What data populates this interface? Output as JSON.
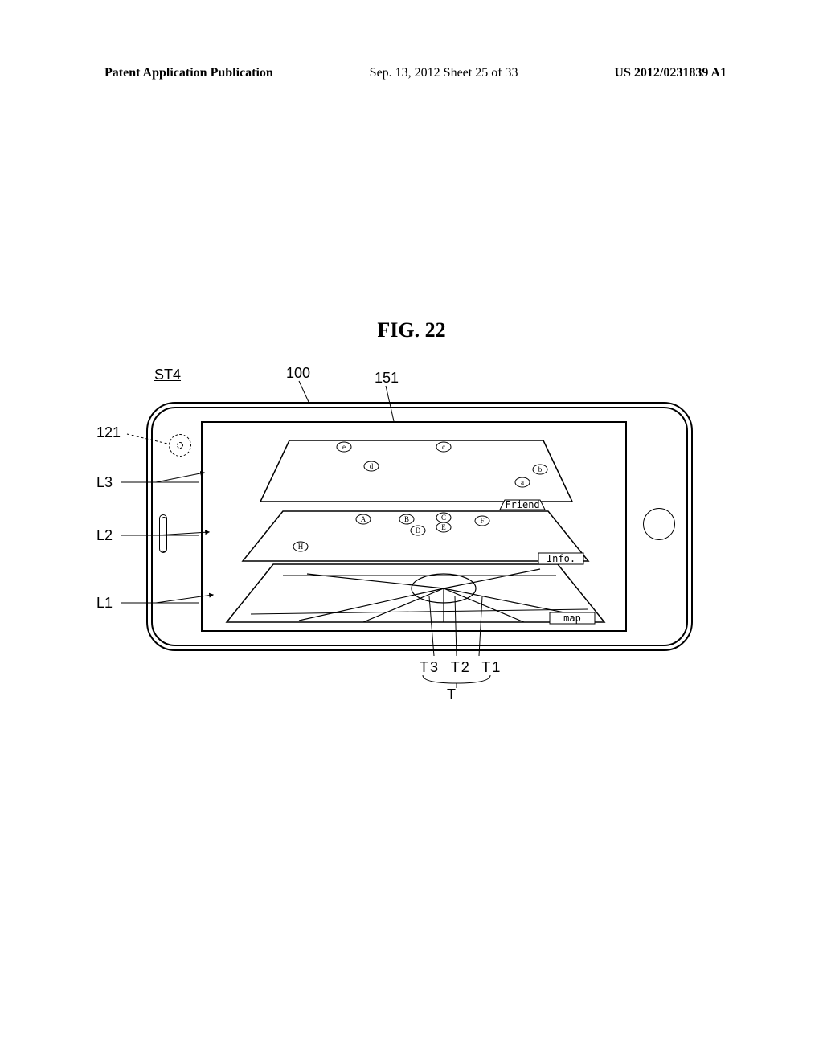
{
  "header": {
    "left": "Patent Application Publication",
    "mid": "Sep. 13, 2012  Sheet 25 of 33",
    "right": "US 2012/0231839 A1"
  },
  "figure_title": "FIG. 22",
  "refs": {
    "st4": "ST4",
    "n100": "100",
    "n151": "151",
    "n121": "121",
    "L3": "L3",
    "L2": "L2",
    "L1": "L1",
    "T3": "T3",
    "T2": "T2",
    "T1": "T1",
    "T": "T"
  },
  "layers": {
    "L1": {
      "tag": "map"
    },
    "L2": {
      "tag": "Info.",
      "points": [
        "A",
        "B",
        "C",
        "D",
        "E",
        "F",
        "H"
      ]
    },
    "L3": {
      "tag": "Friend",
      "points": [
        "a",
        "b",
        "c",
        "d",
        "e"
      ]
    }
  }
}
